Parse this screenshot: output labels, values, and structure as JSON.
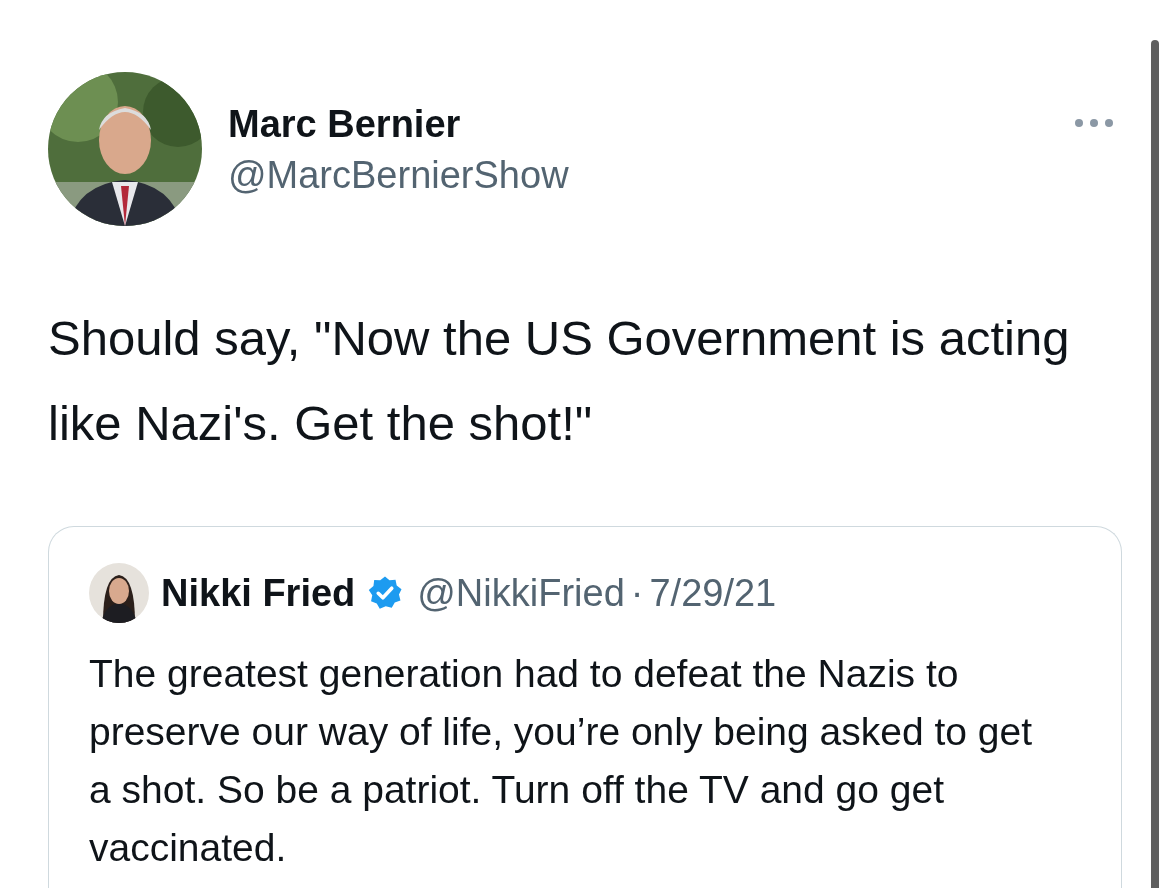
{
  "tweet": {
    "author": {
      "name": "Marc Bernier",
      "handle": "@MarcBernierShow"
    },
    "text": "Should say, \"Now the US Government is acting like Nazi's. Get the shot!\"",
    "quoted": {
      "author": {
        "name": "Nikki Fried",
        "verified": true,
        "handle": "@NikkiFried",
        "separator": "·",
        "date": "7/29/21"
      },
      "text": "The greatest generation had to defeat the Nazis to preserve our way of life, you’re only being asked to get a shot. So be a patriot. Turn off the TV and go get vaccinated."
    }
  }
}
